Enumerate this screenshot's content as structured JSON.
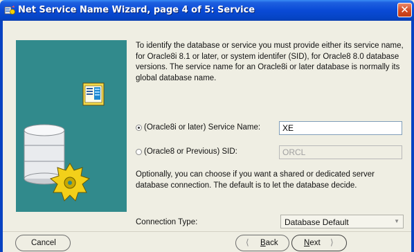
{
  "window": {
    "title": "Net Service Name Wizard, page 4 of 5: Service",
    "close_icon": "close-icon",
    "app_icon": "wizard-icon"
  },
  "description": "To identify the database or service you must provide either its service name, for Oracle8i 8.1 or later, or system identifer (SID), for Oracle8 8.0 database versions. The service name for an Oracle8i or later database is normally its global database name.",
  "service_name": {
    "label": "(Oracle8i or later)  Service Name:",
    "value": "XE",
    "selected": true
  },
  "sid": {
    "label": "(Oracle8 or Previous) SID:",
    "value": "ORCL",
    "selected": false
  },
  "optional_text": "Optionally, you can choose if you want a shared or dedicated server database connection. The default is to let the database decide.",
  "connection_type": {
    "label": "Connection Type:",
    "value": "Database Default"
  },
  "buttons": {
    "cancel": "Cancel",
    "back_prefix": "",
    "back_underline": "B",
    "back_rest": "ack",
    "next_underline": "N",
    "next_rest": "ext"
  },
  "colors": {
    "title_bar": "#0a4ad6",
    "image_panel": "#318a8c",
    "background": "#efeee3"
  }
}
